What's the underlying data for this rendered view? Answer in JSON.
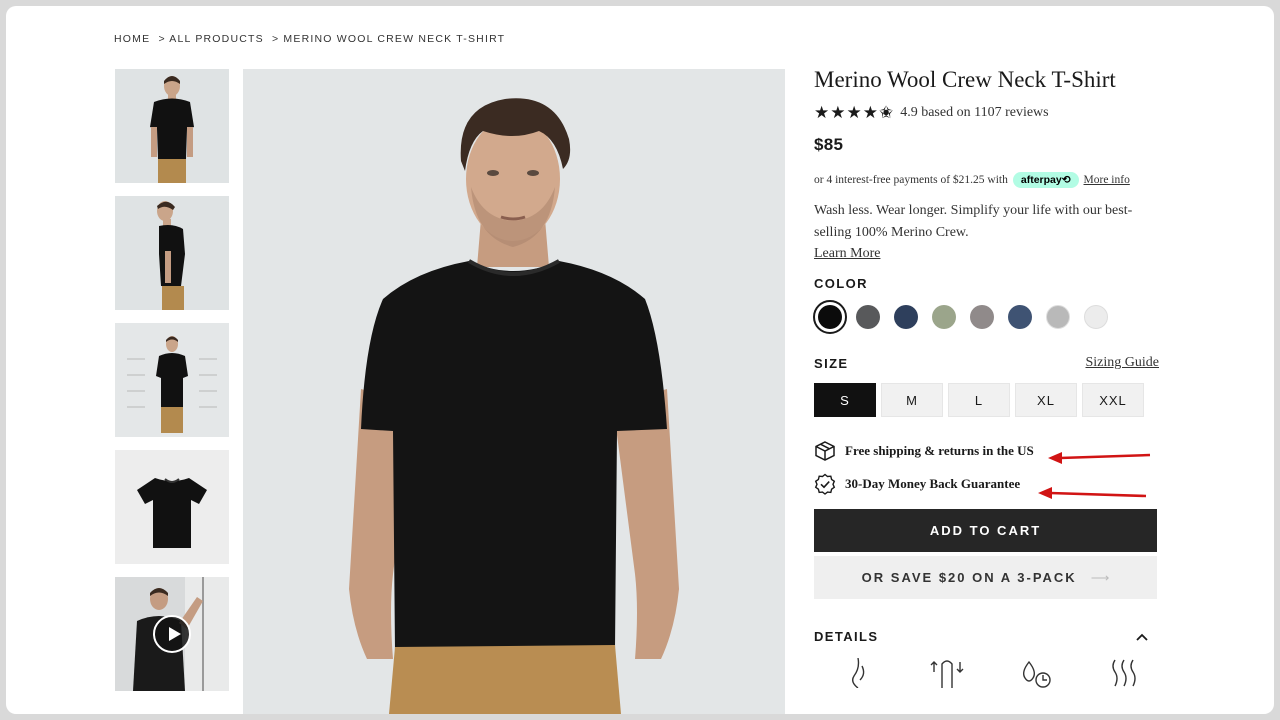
{
  "breadcrumb": {
    "home": "HOME",
    "all_products": "> ALL PRODUCTS",
    "current": "> MERINO WOOL CREW NECK T-SHIRT"
  },
  "gallery": {
    "thumbnails": [
      "front-view",
      "side-view",
      "feature-callouts",
      "flat-lay",
      "video"
    ],
    "video_icon": "play-icon"
  },
  "product": {
    "title": "Merino Wool Crew Neck T-Shirt",
    "stars": "★★★★✬",
    "rating_text": "4.9 based on 1107 reviews",
    "price": "$85",
    "afterpay": {
      "text": "or 4 interest-free payments of $21.25 with",
      "badge": "afterpay⟲",
      "link": "More info"
    },
    "description": "Wash less. Wear longer. Simplify your life with our best-selling 100% Merino Crew.",
    "learn_more": "Learn More"
  },
  "color": {
    "label": "COLOR",
    "swatches": [
      "#0b0b0b",
      "#58595b",
      "#2e3f5c",
      "#9ba58b",
      "#908a8a",
      "#3f5373",
      "#b9b9b9",
      "#ececec"
    ],
    "selected_index": 0
  },
  "size": {
    "label": "SIZE",
    "guide": "Sizing Guide",
    "options": [
      "S",
      "M",
      "L",
      "XL",
      "XXL"
    ],
    "selected": "S"
  },
  "perks": {
    "shipping": "Free shipping & returns in the US",
    "guarantee": "30-Day Money Back Guarantee",
    "shipping_icon": "box-icon",
    "guarantee_icon": "badge-check-icon",
    "annotation_color": "#d11414"
  },
  "actions": {
    "add_to_cart": "ADD TO CART",
    "pack": "OR SAVE $20 ON A 3-PACK",
    "pack_arrow": "⟶"
  },
  "details": {
    "label": "DETAILS",
    "toggle_icon": "chevron-up-icon"
  }
}
